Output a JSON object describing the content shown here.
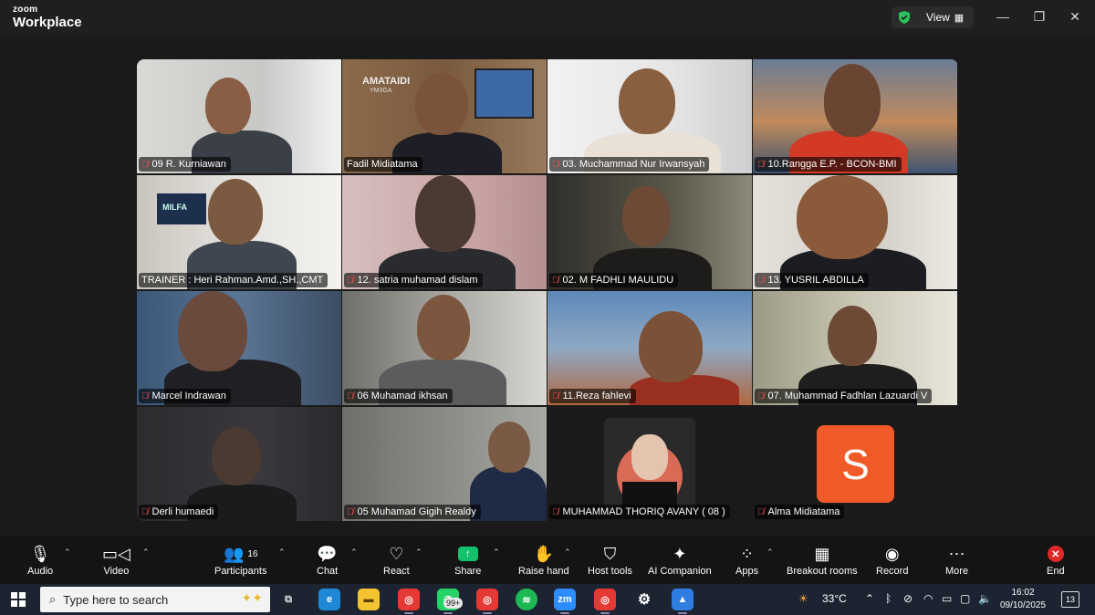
{
  "app": {
    "brand_top": "zoom",
    "brand_bottom": "Workplace",
    "view_label": "View",
    "shield_icon": "green-shield-icon"
  },
  "participants": [
    {
      "name": "09 R. Kurniawan",
      "muted": true
    },
    {
      "name": "Fadil Midiatama",
      "muted": false,
      "active": true
    },
    {
      "name": "03. Muchammad Nur Irwansyah",
      "muted": true
    },
    {
      "name": "10.Rangga E.P. - BCON-BMI",
      "muted": true
    },
    {
      "name": "TRAINER : Heri Rahman.Amd.,SH.,CMT",
      "muted": false
    },
    {
      "name": "12. satria muhamad dislam",
      "muted": true
    },
    {
      "name": "02. M FADHLI MAULIDU",
      "muted": true
    },
    {
      "name": "13. YUSRIL ABDILLA",
      "muted": true
    },
    {
      "name": "Marcel Indrawan",
      "muted": true
    },
    {
      "name": "06 Muhamad ikhsan",
      "muted": true
    },
    {
      "name": "11.Reza fahlevi",
      "muted": true
    },
    {
      "name": "07. Muhammad Fadhlan Lazuardi V",
      "muted": true
    },
    {
      "name": "Derli humaedi",
      "muted": true
    },
    {
      "name": "05 Muhamad Gigih Realdy",
      "muted": true
    },
    {
      "name": "MUHAMMAD THORIQ AVANY ( 08 )",
      "muted": true
    },
    {
      "name": "Alma Midiatama",
      "muted": true,
      "avatar_letter": "S"
    }
  ],
  "scene_text": {
    "wall_sign": "AMATAIDI",
    "wall_sign2": "YM3GA",
    "logo_sign": "MILFA"
  },
  "toolbar": {
    "audio": "Audio",
    "video": "Video",
    "participants": "Participants",
    "participants_count": "16",
    "chat": "Chat",
    "react": "React",
    "share": "Share",
    "raise_hand": "Raise hand",
    "host_tools": "Host tools",
    "ai_companion": "AI Companion",
    "apps": "Apps",
    "breakout_rooms": "Breakout rooms",
    "record": "Record",
    "more": "More",
    "end": "End"
  },
  "taskbar": {
    "search_placeholder": "Type here to search",
    "zoom_app_label": "zm",
    "whatsapp_badge": "99+",
    "weather": "33°C",
    "time": "16:02",
    "date": "09/10/2025",
    "notifications": "13"
  },
  "colors": {
    "active_border": "#32d26b",
    "share_green": "#14c16b",
    "end_red": "#e02828",
    "avatar_orange": "#f05a28"
  }
}
